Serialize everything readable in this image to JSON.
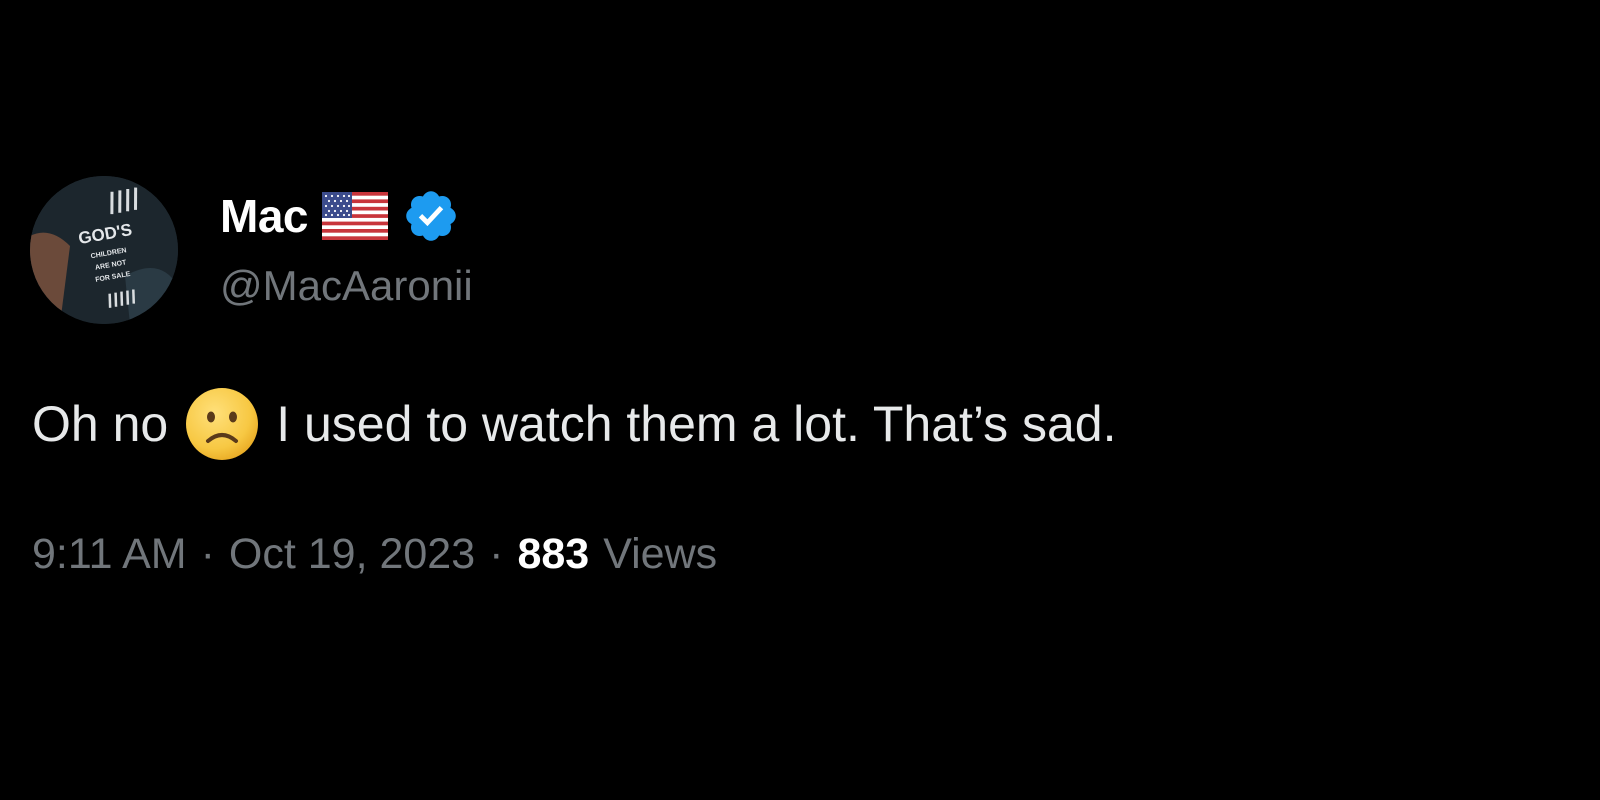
{
  "tweet": {
    "author": {
      "display_name": "Mac",
      "handle": "@MacAaronii",
      "flag_icon": "us-flag-icon",
      "verified_icon": "verified-badge-icon",
      "verified_color": "#1d9bf0",
      "avatar_text": [
        "GOD'S",
        "CHILDREN",
        "ARE NOT",
        "FOR SALE"
      ]
    },
    "text_before_emoji": "Oh no",
    "emoji": "slightly-frowning-face-emoji",
    "text_after_emoji": "I used to watch them a lot. That’s sad.",
    "meta": {
      "time": "9:11 AM",
      "separator": "·",
      "date": "Oct 19, 2023",
      "views_count": "883",
      "views_label": "Views"
    }
  },
  "colors": {
    "background": "#000000",
    "primary_text": "#e7e9ea",
    "secondary_text": "#71767b",
    "accent": "#1d9bf0"
  }
}
